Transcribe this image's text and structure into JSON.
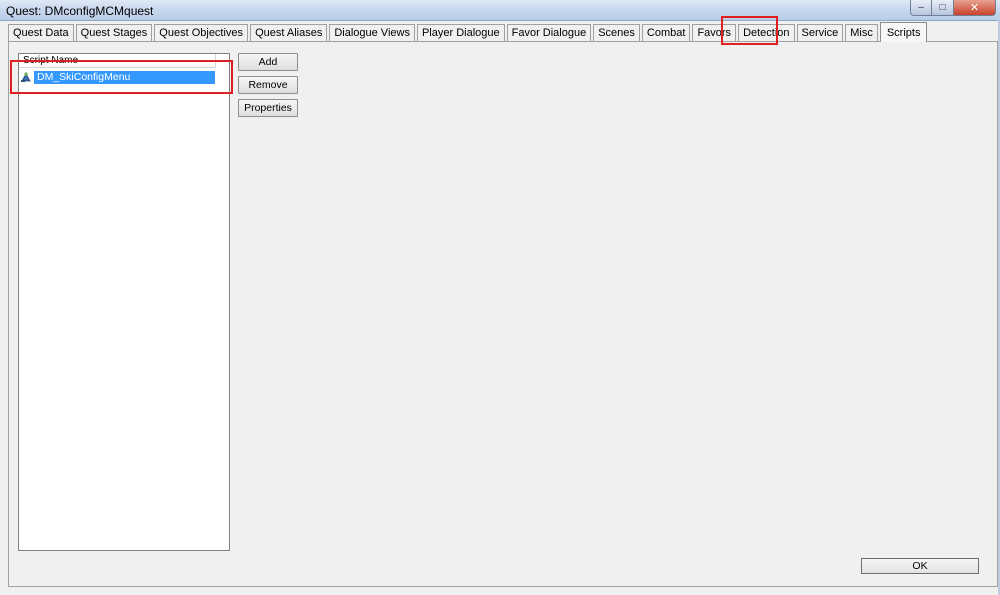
{
  "window": {
    "title": "Quest: DMconfigMCMquest",
    "minimize_glyph": "–",
    "maximize_glyph": "□",
    "close_glyph": "✕"
  },
  "tabs": [
    {
      "label": "Quest Data"
    },
    {
      "label": "Quest Stages"
    },
    {
      "label": "Quest Objectives"
    },
    {
      "label": "Quest Aliases"
    },
    {
      "label": "Dialogue Views"
    },
    {
      "label": "Player Dialogue"
    },
    {
      "label": "Favor Dialogue"
    },
    {
      "label": "Scenes"
    },
    {
      "label": "Combat"
    },
    {
      "label": "Favors"
    },
    {
      "label": "Detection"
    },
    {
      "label": "Service"
    },
    {
      "label": "Misc"
    },
    {
      "label": "Scripts",
      "active": true
    }
  ],
  "scripts_panel": {
    "column_header": "Script Name",
    "rows": [
      {
        "name": "DM_SkiConfigMenu",
        "icon": "script-icon",
        "selected": true
      }
    ],
    "buttons": {
      "add": "Add",
      "remove": "Remove",
      "properties": "Properties"
    }
  },
  "footer": {
    "ok": "OK"
  },
  "colors": {
    "selection": "#3399ff",
    "annotation_box": "#e02020"
  }
}
